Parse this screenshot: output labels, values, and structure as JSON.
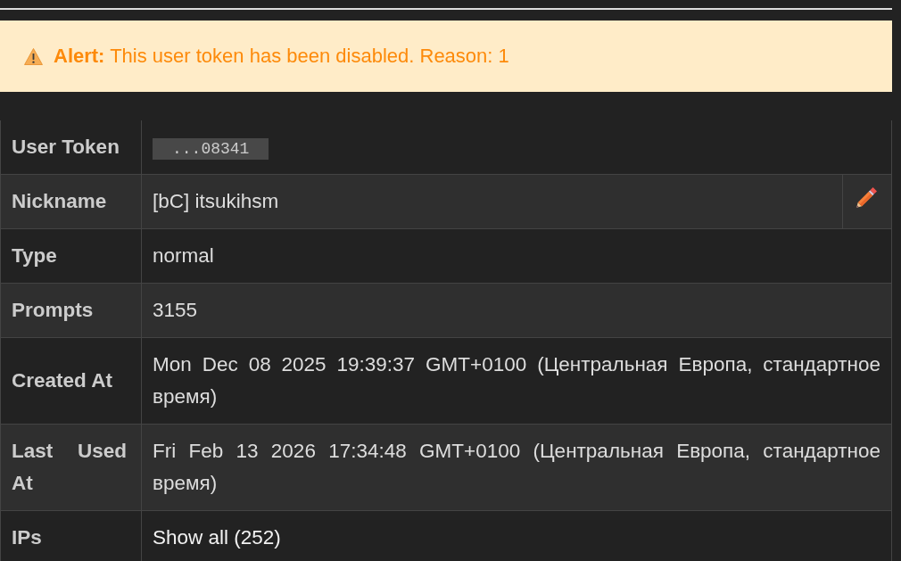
{
  "alert": {
    "message": "**Alert:** This user token has been disabled. Reason: 1"
  },
  "details": [
    {
      "kind": "code",
      "label": "User Token",
      "value": "...08341"
    },
    {
      "kind": "editable",
      "label": "Nickname",
      "value": "[bC] itsukihsm"
    },
    {
      "kind": "text",
      "label": "Type",
      "value": "normal"
    },
    {
      "kind": "text",
      "label": "Prompts",
      "value": "3155"
    },
    {
      "kind": "text",
      "label": "Created At",
      "value": "Mon Dec 08 2025 19:39:37 GMT+0100 (Центральная Европа, стандартное время)"
    },
    {
      "kind": "text",
      "label": "Last Used At",
      "value": "Fri Feb 13 2026 17:34:48 GMT+0100 (Центральная Европа, стандартное время)"
    },
    {
      "kind": "link",
      "label": "IPs",
      "value": "Show all (252)"
    }
  ]
}
